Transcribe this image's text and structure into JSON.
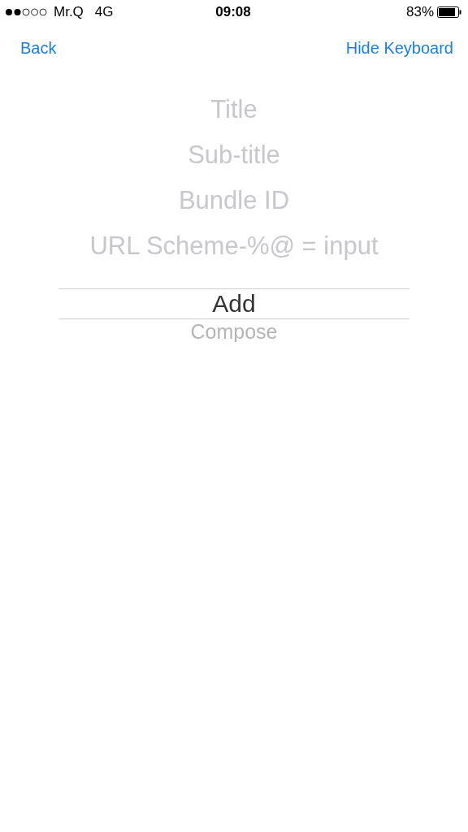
{
  "status_bar": {
    "carrier": "Mr.Q",
    "network": "4G",
    "time": "09:08",
    "battery": "83%"
  },
  "nav": {
    "back": "Back",
    "action": "Hide Keyboard"
  },
  "fields": [
    {
      "placeholder": "Title"
    },
    {
      "placeholder": "Sub-title"
    },
    {
      "placeholder": "Bundle ID"
    },
    {
      "placeholder": "URL Scheme-%@ = input"
    }
  ],
  "picker": [
    {
      "label": "Add",
      "selected": true
    },
    {
      "label": "Compose",
      "selected": false
    }
  ]
}
